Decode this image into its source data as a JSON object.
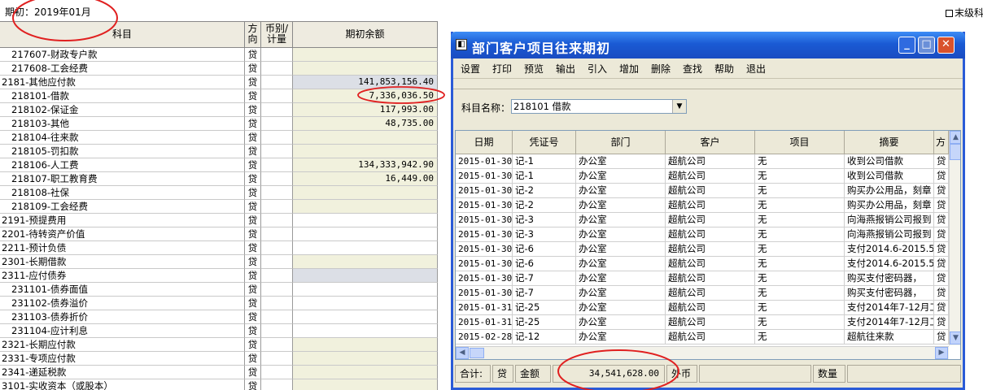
{
  "header": {
    "period": "期初：2019年01月",
    "leaf_only_label": "末级科"
  },
  "ledger": {
    "columns": {
      "subject": "科目",
      "direction": "方\n向",
      "currency": "币别/\n计量",
      "opening": "期初余额"
    },
    "rows": [
      {
        "subject": "217607-财政专户款",
        "dir": "贷",
        "amount": "",
        "level": 2,
        "bg": "y"
      },
      {
        "subject": "217608-工会经费",
        "dir": "贷",
        "amount": "",
        "level": 2,
        "bg": "y"
      },
      {
        "subject": "2181-其他应付款",
        "dir": "贷",
        "amount": "141,853,156.40",
        "level": 1,
        "bg": "b"
      },
      {
        "subject": "218101-借款",
        "dir": "贷",
        "amount": "7,336,036.50",
        "level": 2,
        "bg": "y"
      },
      {
        "subject": "218102-保证金",
        "dir": "贷",
        "amount": "117,993.00",
        "level": 2,
        "bg": "y"
      },
      {
        "subject": "218103-其他",
        "dir": "贷",
        "amount": "48,735.00",
        "level": 2,
        "bg": "y"
      },
      {
        "subject": "218104-往来款",
        "dir": "贷",
        "amount": "",
        "level": 2,
        "bg": "y"
      },
      {
        "subject": "218105-罚扣款",
        "dir": "贷",
        "amount": "",
        "level": 2,
        "bg": "y"
      },
      {
        "subject": "218106-人工费",
        "dir": "贷",
        "amount": "134,333,942.90",
        "level": 2,
        "bg": "y"
      },
      {
        "subject": "218107-职工教育费",
        "dir": "贷",
        "amount": "16,449.00",
        "level": 2,
        "bg": "y"
      },
      {
        "subject": "218108-社保",
        "dir": "贷",
        "amount": "",
        "level": 2,
        "bg": "y"
      },
      {
        "subject": "218109-工会经费",
        "dir": "贷",
        "amount": "",
        "level": 2,
        "bg": "y"
      },
      {
        "subject": "2191-预提费用",
        "dir": "贷",
        "amount": "",
        "level": 1,
        "bg": "w"
      },
      {
        "subject": "2201-待转资产价值",
        "dir": "贷",
        "amount": "",
        "level": 1,
        "bg": "w"
      },
      {
        "subject": "2211-预计负债",
        "dir": "贷",
        "amount": "",
        "level": 1,
        "bg": "w"
      },
      {
        "subject": "2301-长期借款",
        "dir": "贷",
        "amount": "",
        "level": 1,
        "bg": "y"
      },
      {
        "subject": "2311-应付债券",
        "dir": "贷",
        "amount": "",
        "level": 1,
        "bg": "b"
      },
      {
        "subject": "231101-债券面值",
        "dir": "贷",
        "amount": "",
        "level": 2,
        "bg": "w"
      },
      {
        "subject": "231102-债券溢价",
        "dir": "贷",
        "amount": "",
        "level": 2,
        "bg": "w"
      },
      {
        "subject": "231103-债券折价",
        "dir": "贷",
        "amount": "",
        "level": 2,
        "bg": "w"
      },
      {
        "subject": "231104-应计利息",
        "dir": "贷",
        "amount": "",
        "level": 2,
        "bg": "w"
      },
      {
        "subject": "2321-长期应付款",
        "dir": "贷",
        "amount": "",
        "level": 1,
        "bg": "y"
      },
      {
        "subject": "2331-专项应付款",
        "dir": "贷",
        "amount": "",
        "level": 1,
        "bg": "y"
      },
      {
        "subject": "2341-递延税款",
        "dir": "贷",
        "amount": "",
        "level": 1,
        "bg": "y"
      },
      {
        "subject": "3101-实收资本（或股本）",
        "dir": "贷",
        "amount": "",
        "level": 1,
        "bg": "y"
      }
    ]
  },
  "dialog": {
    "title": "部门客户项目往来期初",
    "window_buttons": {
      "minimize": "_",
      "maximize": "□",
      "close": "✕"
    },
    "menu": [
      "设置",
      "打印",
      "预览",
      "输出",
      "引入",
      "增加",
      "删除",
      "查找",
      "帮助",
      "退出"
    ],
    "subject_label": "科目名称：",
    "subject_value": "218101 借款",
    "columns": [
      "日期",
      "凭证号",
      "部门",
      "客户",
      "项目",
      "摘要",
      "方"
    ],
    "rows": [
      {
        "date": "2015-01-30",
        "voucher": "记-1",
        "dept": "办公室",
        "customer": "超航公司",
        "project": "无",
        "summary": "收到公司借款",
        "dir": "贷"
      },
      {
        "date": "2015-01-30",
        "voucher": "记-1",
        "dept": "办公室",
        "customer": "超航公司",
        "project": "无",
        "summary": "收到公司借款",
        "dir": "贷"
      },
      {
        "date": "2015-01-30",
        "voucher": "记-2",
        "dept": "办公室",
        "customer": "超航公司",
        "project": "无",
        "summary": "购买办公用品，刻章",
        "dir": "贷"
      },
      {
        "date": "2015-01-30",
        "voucher": "记-2",
        "dept": "办公室",
        "customer": "超航公司",
        "project": "无",
        "summary": "购买办公用品，刻章",
        "dir": "贷"
      },
      {
        "date": "2015-01-30",
        "voucher": "记-3",
        "dept": "办公室",
        "customer": "超航公司",
        "project": "无",
        "summary": "向海燕报销公司报到",
        "dir": "贷"
      },
      {
        "date": "2015-01-30",
        "voucher": "记-3",
        "dept": "办公室",
        "customer": "超航公司",
        "project": "无",
        "summary": "向海燕报销公司报到",
        "dir": "贷"
      },
      {
        "date": "2015-01-30",
        "voucher": "记-6",
        "dept": "办公室",
        "customer": "超航公司",
        "project": "无",
        "summary": "支付2014.6-2015.5.",
        "dir": "贷"
      },
      {
        "date": "2015-01-30",
        "voucher": "记-6",
        "dept": "办公室",
        "customer": "超航公司",
        "project": "无",
        "summary": "支付2014.6-2015.5.",
        "dir": "贷"
      },
      {
        "date": "2015-01-30",
        "voucher": "记-7",
        "dept": "办公室",
        "customer": "超航公司",
        "project": "无",
        "summary": "购买支付密码器，",
        "dir": "贷"
      },
      {
        "date": "2015-01-30",
        "voucher": "记-7",
        "dept": "办公室",
        "customer": "超航公司",
        "project": "无",
        "summary": "购买支付密码器，",
        "dir": "贷"
      },
      {
        "date": "2015-01-31",
        "voucher": "记-25",
        "dept": "办公室",
        "customer": "超航公司",
        "project": "无",
        "summary": "支付2014年7-12月工",
        "dir": "贷"
      },
      {
        "date": "2015-01-31",
        "voucher": "记-25",
        "dept": "办公室",
        "customer": "超航公司",
        "project": "无",
        "summary": "支付2014年7-12月工",
        "dir": "贷"
      },
      {
        "date": "2015-02-28",
        "voucher": "记-12",
        "dept": "办公室",
        "customer": "超航公司",
        "project": "无",
        "summary": "超航往来款",
        "dir": "贷"
      }
    ],
    "totals": {
      "label": "合计:",
      "direction": "贷",
      "amount_label": "金额",
      "amount": "34,541,628.00",
      "foreign_label": "外币",
      "foreign_value": "",
      "qty_label": "数量",
      "qty_value": ""
    }
  },
  "colors": {
    "title_bar": "#1a5ad4",
    "annotation": "#e02020",
    "cell_yellow": "#f1f1dd",
    "cell_blue": "#dcdfe6"
  }
}
